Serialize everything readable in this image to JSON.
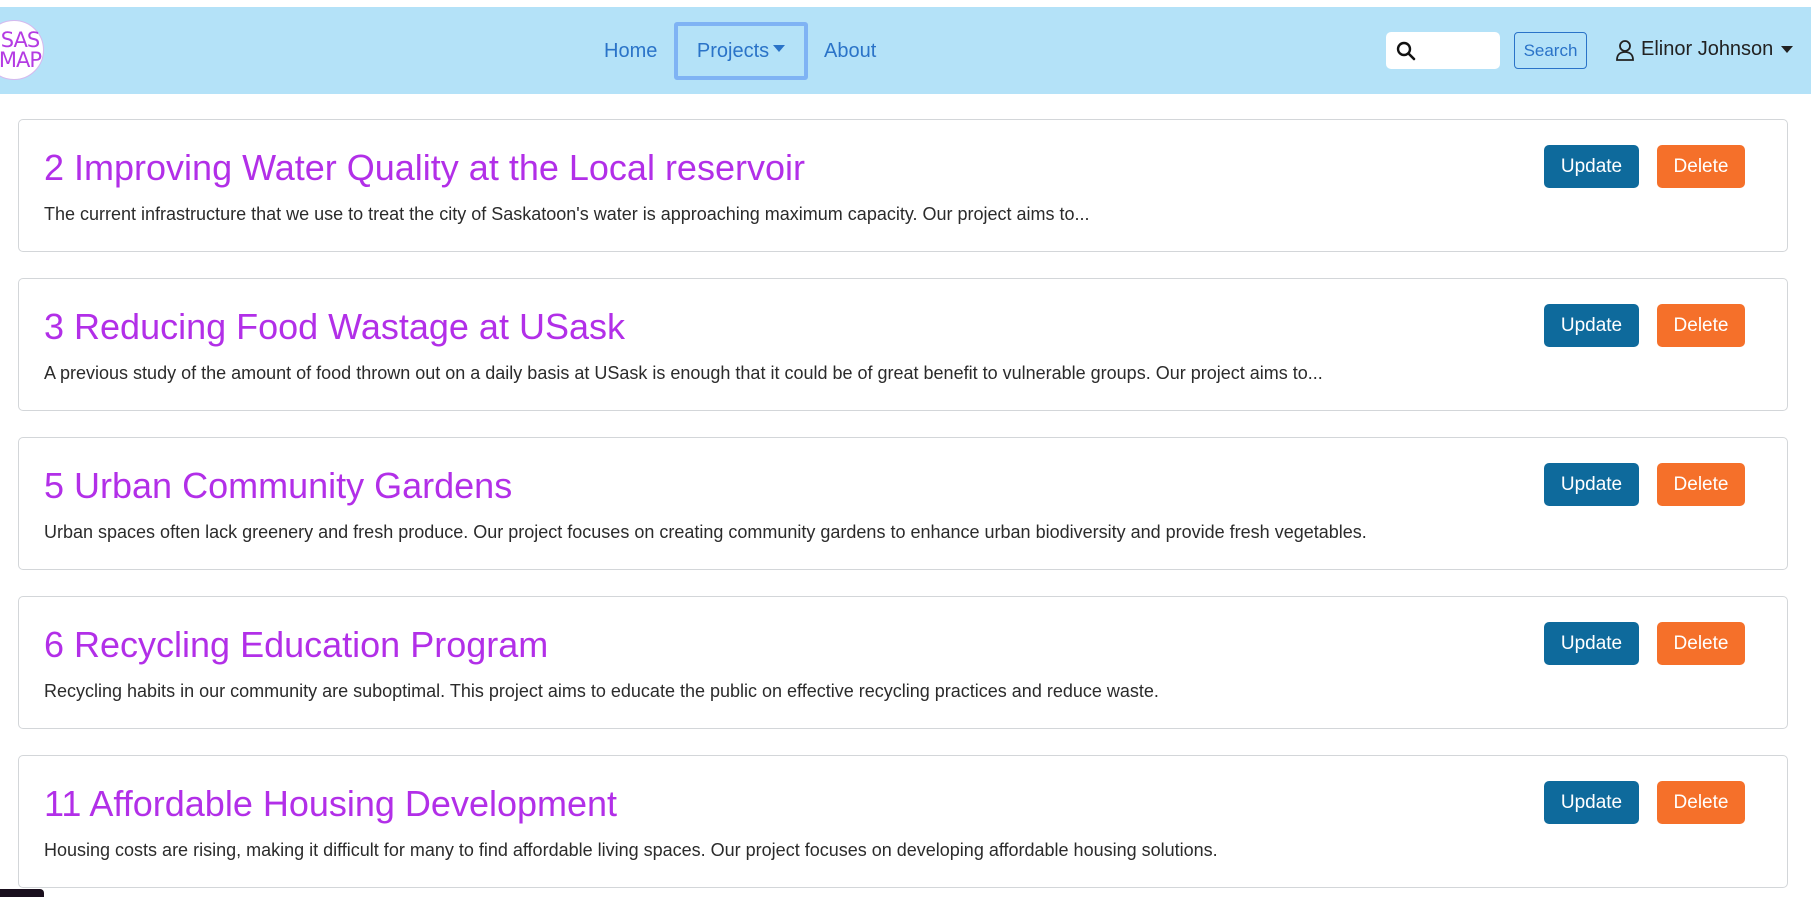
{
  "logo": {
    "line1": "SAS",
    "line2": "MAP"
  },
  "nav": {
    "home": "Home",
    "projects": "Projects",
    "about": "About"
  },
  "search": {
    "placeholder": "",
    "button_label": "Search"
  },
  "user": {
    "name": "Elinor Johnson"
  },
  "colors": {
    "navbar_bg": "#b4e2f8",
    "title": "#b22fe8",
    "update_button": "#0e6a9c",
    "delete_button": "#f5702a",
    "link": "#2a73c8"
  },
  "projects": [
    {
      "title": "2 Improving Water Quality at the Local reservoir",
      "description": "The current infrastructure that we use to treat the city of Saskatoon's water is approaching maximum capacity. Our project aims to...",
      "update_label": "Update",
      "delete_label": "Delete"
    },
    {
      "title": "3 Reducing Food Wastage at USask",
      "description": "A previous study of the amount of food thrown out on a daily basis at USask is enough that it could be of great benefit to vulnerable groups. Our project aims to...",
      "update_label": "Update",
      "delete_label": "Delete"
    },
    {
      "title": "5 Urban Community Gardens",
      "description": "Urban spaces often lack greenery and fresh produce. Our project focuses on creating community gardens to enhance urban biodiversity and provide fresh vegetables.",
      "update_label": "Update",
      "delete_label": "Delete"
    },
    {
      "title": "6 Recycling Education Program",
      "description": "Recycling habits in our community are suboptimal. This project aims to educate the public on effective recycling practices and reduce waste.",
      "update_label": "Update",
      "delete_label": "Delete"
    },
    {
      "title": "11 Affordable Housing Development",
      "description": "Housing costs are rising, making it difficult for many to find affordable living spaces. Our project focuses on developing affordable housing solutions.",
      "update_label": "Update",
      "delete_label": "Delete"
    }
  ]
}
